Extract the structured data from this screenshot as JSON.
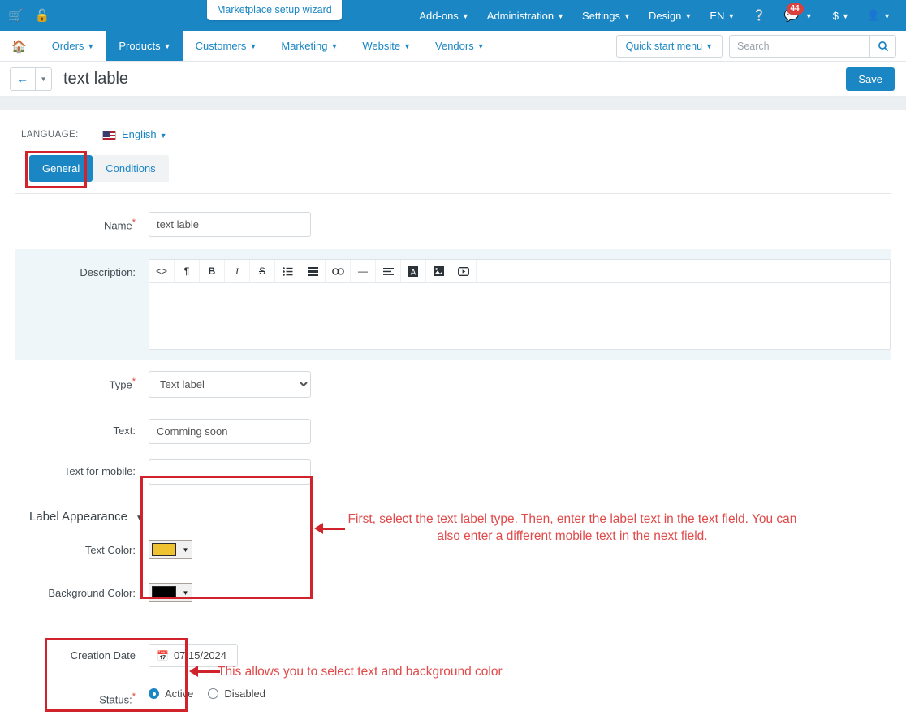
{
  "topbar": {
    "cart_icon": "cart-icon",
    "unlock_icon": "unlock-icon",
    "wizard_tip": "Marketplace setup wizard",
    "menus": [
      {
        "label": "Add-ons",
        "name": "addons"
      },
      {
        "label": "Administration",
        "name": "administration"
      },
      {
        "label": "Settings",
        "name": "settings"
      },
      {
        "label": "Design",
        "name": "design"
      },
      {
        "label": "EN",
        "name": "language"
      }
    ],
    "help_icon": "help-icon",
    "bell_icon": "bell-icon",
    "notification_count": "44",
    "currency": "$",
    "user_icon": "user-icon"
  },
  "navbar": {
    "home_icon": "home-icon",
    "items": [
      {
        "label": "Orders",
        "name": "orders"
      },
      {
        "label": "Products",
        "name": "products"
      },
      {
        "label": "Customers",
        "name": "customers"
      },
      {
        "label": "Marketing",
        "name": "marketing"
      },
      {
        "label": "Website",
        "name": "website"
      },
      {
        "label": "Vendors",
        "name": "vendors"
      }
    ],
    "quick_start_menu": "Quick start menu",
    "search_placeholder": "Search",
    "search_value": ""
  },
  "titlebar": {
    "back_icon": "arrow-left-icon",
    "title": "text lable",
    "save_label": "Save"
  },
  "language_row": {
    "label": "LANGUAGE:",
    "value": "English"
  },
  "tabs": [
    {
      "label": "General",
      "name": "general",
      "active": true
    },
    {
      "label": "Conditions",
      "name": "conditions",
      "active": false
    }
  ],
  "form": {
    "name_label": "Name",
    "name_value": "text lable",
    "description_label": "Description:",
    "description_value": "",
    "editor_buttons": [
      {
        "name": "code-icon",
        "glyph": "<>"
      },
      {
        "name": "paragraph-icon",
        "glyph": "¶"
      },
      {
        "name": "bold-icon",
        "glyph": "B"
      },
      {
        "name": "italic-icon",
        "glyph": "I"
      },
      {
        "name": "strikethrough-icon",
        "glyph": "S̶"
      },
      {
        "name": "unordered-list-icon",
        "glyph": "☰"
      },
      {
        "name": "table-icon",
        "glyph": "⌸"
      },
      {
        "name": "link-icon",
        "glyph": "∞"
      },
      {
        "name": "horizontal-rule-icon",
        "glyph": "—"
      },
      {
        "name": "align-icon",
        "glyph": "≡"
      },
      {
        "name": "text-color-icon",
        "glyph": "A"
      },
      {
        "name": "image-icon",
        "glyph": "▣"
      },
      {
        "name": "video-icon",
        "glyph": "▶"
      }
    ],
    "type_label": "Type",
    "type_value": "Text label",
    "type_options": [
      "Text label"
    ],
    "text_label": "Text:",
    "text_value": "Comming soon",
    "text_mobile_label": "Text for mobile:",
    "text_mobile_value": "",
    "creation_date_label": "Creation Date",
    "creation_date_value": "07/15/2024",
    "status_label": "Status:",
    "status_active": "Active",
    "status_disabled": "Disabled"
  },
  "appearance": {
    "title": "Label Appearance",
    "text_color_label": "Text Color:",
    "text_color_value": "#efc32f",
    "background_color_label": "Background Color:",
    "background_color_value": "#000000"
  },
  "annotations": {
    "fields_note": "First, select the text label type. Then, enter the label text in the text field. You can also enter a different mobile text in the next field.",
    "colors_note": "This allows you to select text and background color",
    "highlight_color": "#d0232b",
    "note_color": "#e04a4a"
  }
}
